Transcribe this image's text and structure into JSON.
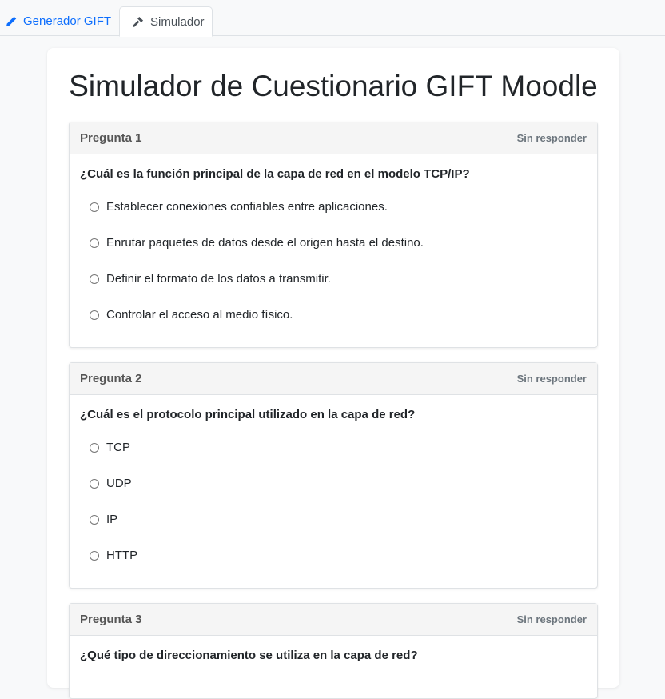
{
  "tabs": [
    {
      "label": "Generador GIFT",
      "icon": "pencil-icon",
      "active": false
    },
    {
      "label": "Simulador",
      "icon": "tool-icon",
      "active": true
    }
  ],
  "page": {
    "title": "Simulador de Cuestionario GIFT Moodle"
  },
  "questions": [
    {
      "header": "Pregunta 1",
      "status": "Sin responder",
      "text": "¿Cuál es la función principal de la capa de red en el modelo TCP/IP?",
      "options": [
        "Establecer conexiones confiables entre aplicaciones.",
        "Enrutar paquetes de datos desde el origen hasta el destino.",
        "Definir el formato de los datos a transmitir.",
        "Controlar el acceso al medio físico."
      ]
    },
    {
      "header": "Pregunta 2",
      "status": "Sin responder",
      "text": "¿Cuál es el protocolo principal utilizado en la capa de red?",
      "options": [
        "TCP",
        "UDP",
        "IP",
        "HTTP"
      ]
    },
    {
      "header": "Pregunta 3",
      "status": "Sin responder",
      "text": "¿Qué tipo de direccionamiento se utiliza en la capa de red?",
      "options": []
    }
  ],
  "colors": {
    "accent": "#0d6efd",
    "background": "#f8f9fa",
    "card_header": "#f5f5f5"
  }
}
